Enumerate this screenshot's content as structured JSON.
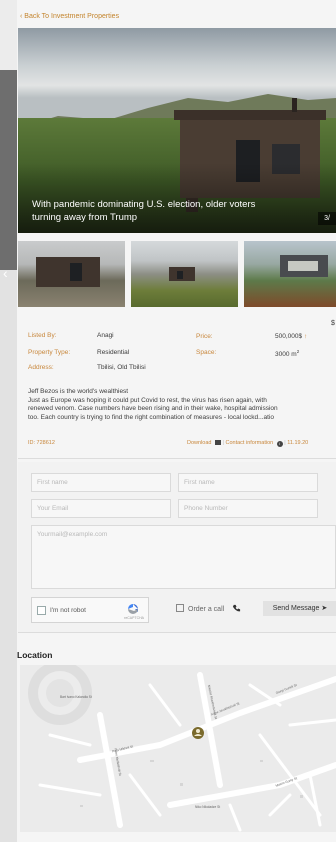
{
  "nav": {
    "back_label": "‹ Back To Investment Properties"
  },
  "gallery": {
    "caption": "With pandemic dominating U.S. election, older voters turning away from Trump",
    "counter": "3/",
    "prev_icon": "chevron-left-icon"
  },
  "details": {
    "listed_by_label": "Listed By:",
    "listed_by_value": "Anagi",
    "property_type_label": "Property Type:",
    "property_type_value": "Residential",
    "address_label": "Address:",
    "address_value": "Tbilisi, Old Tbilisi",
    "price_label": "Price:",
    "price_value": "500,000$",
    "space_label": "Space:",
    "space_value": "3000 m",
    "space_unit_sup": "2",
    "currency_symbol": "$",
    "description_lines": [
      "Jeff Bezos is the world's wealthiest",
      "Just as Europe was hoping it could put Covid to rest, the virus has risen again, with",
      "renewed venom. Case numbers have been rising and in their wake, hospital admission",
      "too. Each country is trying to find the right combination of measures - local lockd...atio"
    ],
    "id_text": "ID: 728612",
    "download_label": "Download",
    "contact_label": "Contact information",
    "date_text": "11.19.20"
  },
  "form": {
    "first_name_placeholder": "First name",
    "first_name2_placeholder": "First name",
    "email_placeholder": "Your Email",
    "phone_placeholder": "Phone Number",
    "message_placeholder": "Yourmail@example.com",
    "captcha_label": "I'm not robot",
    "captcha_brand": "reCAPTCHA",
    "order_call_label": "Order a call",
    "send_label": "Send Message"
  },
  "location": {
    "title": "Location"
  },
  "map_labels": [
    "Peta Mikheil St",
    "Ivane Javakhishvili St",
    "Giorgi Gurieli St",
    "Petre Melikishvili St",
    "Nikoloz Muskhelishvili St",
    "Niko Nikoladze St",
    "Bart Ivano Kalandia St",
    "Maxim Gorky St"
  ],
  "colors": {
    "accent": "#c8873c",
    "pin": "#7a6a2c"
  }
}
